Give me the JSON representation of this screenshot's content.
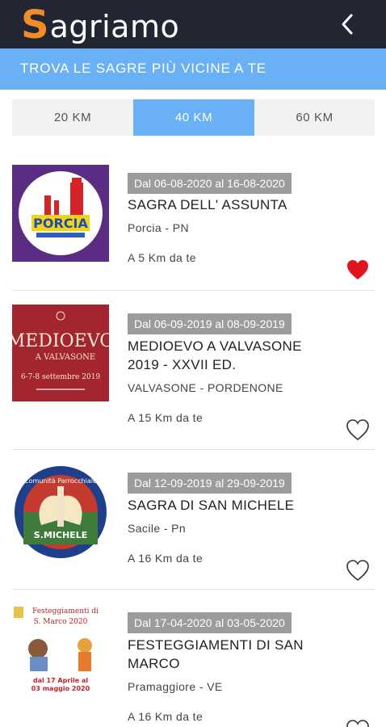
{
  "app": {
    "logo_initial": "S",
    "logo_rest": "agriamo",
    "back_icon": "chevron-left-icon",
    "colors": {
      "appbar": "#222632",
      "logo_accent": "#f28c28",
      "accent": "#6ab0f5",
      "heart_active": "#e0141e",
      "date_badge": "#9c9c9c"
    }
  },
  "banner": {
    "text": "TROVA LE SAGRE PIÙ VICINE A TE"
  },
  "tabs": [
    {
      "label": "20 KM",
      "selected": false
    },
    {
      "label": "40 KM",
      "selected": true
    },
    {
      "label": "60 KM",
      "selected": false
    }
  ],
  "events": [
    {
      "dates": "Dal 06-08-2020 al 16-08-2020",
      "title": "SAGRA DELL' ASSUNTA",
      "location": "Porcia - PN",
      "distance": "A 5 Km da te",
      "favorite": true,
      "thumb_text": "PORCIA"
    },
    {
      "dates": "Dal 06-09-2019 al 08-09-2019",
      "title": "MEDIOEVO A VALVASONE 2019 - XXVII ED.",
      "location": "VALVASONE - PORDENONE",
      "distance": "A 15 Km da te",
      "favorite": false,
      "thumb_text": "MEDIOEVO",
      "thumb_sub": "A VALVASONE",
      "thumb_date": "6-7-8 settembre 2019"
    },
    {
      "dates": "Dal 12-09-2019 al 29-09-2019",
      "title": "SAGRA DI SAN MICHELE",
      "location": "Sacile - Pn",
      "distance": "A 16 Km da te",
      "favorite": false,
      "thumb_text": "Comunità Parrocchiale",
      "thumb_sub": "S.MICHELE"
    },
    {
      "dates": "Dal 17-04-2020 al 03-05-2020",
      "title": "FESTEGGIAMENTI DI SAN MARCO",
      "location": "Pramaggiore - VE",
      "distance": "A 16 Km da te",
      "favorite": false,
      "thumb_text": "Festeggiamenti di",
      "thumb_sub": "S. Marco 2020",
      "thumb_date": "dal 17 Aprile al",
      "thumb_date2": "03 maggio 2020"
    }
  ]
}
